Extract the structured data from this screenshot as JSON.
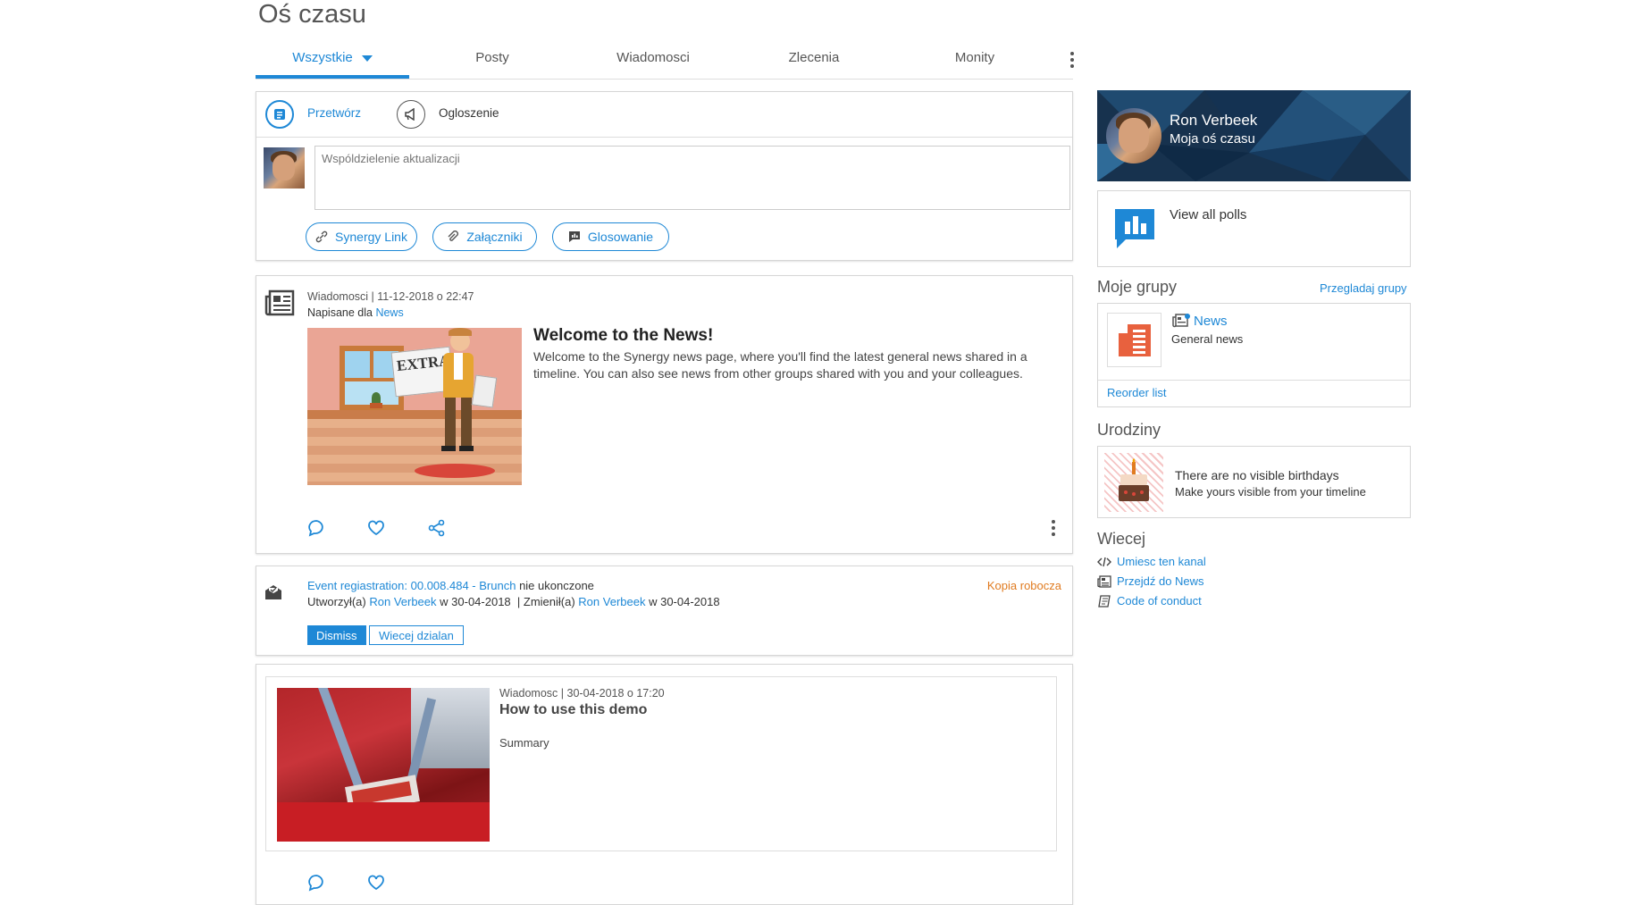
{
  "page": {
    "title": "Oś czasu"
  },
  "tabs": [
    {
      "label": "Wszystkie"
    },
    {
      "label": "Posty"
    },
    {
      "label": "Wiadomosci"
    },
    {
      "label": "Zlecenia"
    },
    {
      "label": "Monity"
    }
  ],
  "composer": {
    "action1": "Przetwórz",
    "action2": "Ogloszenie",
    "placeholder": "Wspóldzielenie aktualizacji",
    "btn_link": "Synergy Link",
    "btn_attach": "Załączniki",
    "btn_poll": "Glosowanie"
  },
  "news_post": {
    "meta_type": "Wiadomosci",
    "meta_date": "11-12-2018 o 22:47",
    "written_for": "Napisane dla",
    "group": "News",
    "title": "Welcome to the News!",
    "body": "Welcome to the Synergy news page, where you'll find the latest general news shared in a timeline. You can also see news from other groups shared with you and your colleagues.",
    "image_text": "EXTRA"
  },
  "task": {
    "link": "Event regiastration: 00.008.484 - Brunch",
    "status": "nie ukonczone",
    "draft": "Kopia robocza",
    "created_by_label": "Utworzył(a)",
    "created_by": "Ron Verbeek",
    "created_on": "w 30-04-2018",
    "changed_by_label": "| Zmienił(a)",
    "changed_by": "Ron Verbeek",
    "changed_on": "w 30-04-2018",
    "dismiss": "Dismiss",
    "more": "Wiecej dzialan"
  },
  "demo_post": {
    "meta_type": "Wiadomosc",
    "meta_date": "30-04-2018 o 17:20",
    "title": "How to use this demo",
    "summary": "Summary"
  },
  "profile": {
    "name": "Ron Verbeek",
    "subtitle": "Moja oś czasu"
  },
  "polls": {
    "label": "View all polls"
  },
  "groups": {
    "title": "Moje grupy",
    "browse": "Przegladaj grupy",
    "item_name": "News",
    "item_desc": "General news",
    "reorder": "Reorder list"
  },
  "birthdays": {
    "title": "Urodziny",
    "line1": "There are no visible birthdays",
    "line2": "Make yours visible from your timeline"
  },
  "more": {
    "title": "Wiecej",
    "links": [
      "Umiesc ten kanal",
      "Przejdź do News",
      "Code of conduct"
    ]
  },
  "colors": {
    "accent": "#1e88d6",
    "draft": "#e07b20",
    "profile_bg": "#17324e"
  }
}
